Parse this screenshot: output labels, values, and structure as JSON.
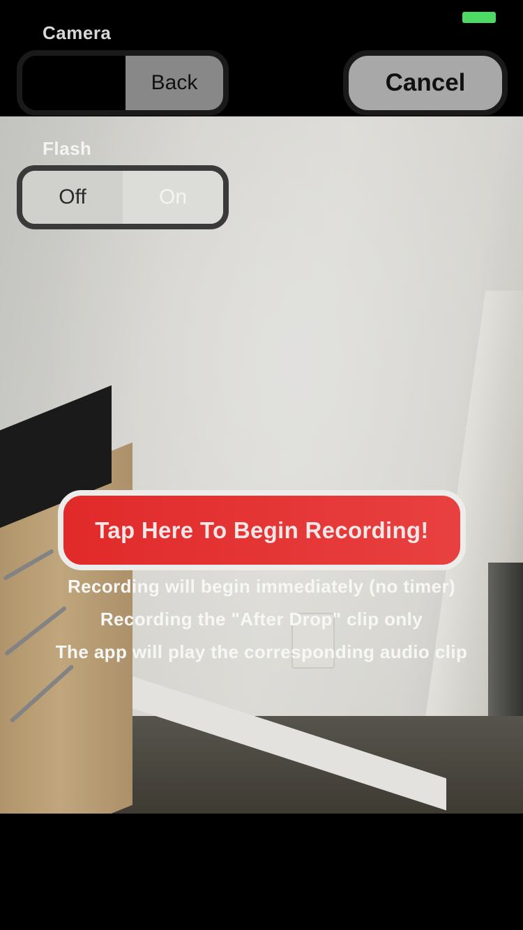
{
  "status_bar": {
    "battery_color": "#4cd964"
  },
  "header": {
    "title": "Camera",
    "back_label": "Back",
    "cancel_label": "Cancel"
  },
  "flash": {
    "label": "Flash",
    "options": [
      "Off",
      "On"
    ],
    "selected": "Off"
  },
  "record": {
    "button_label": "Tap Here To Begin Recording!",
    "info_lines": [
      "Recording will begin immediately (no timer)",
      "Recording the \"After Drop\" clip only",
      "The app will play the corresponding audio clip"
    ],
    "button_color": "#e3302f"
  }
}
